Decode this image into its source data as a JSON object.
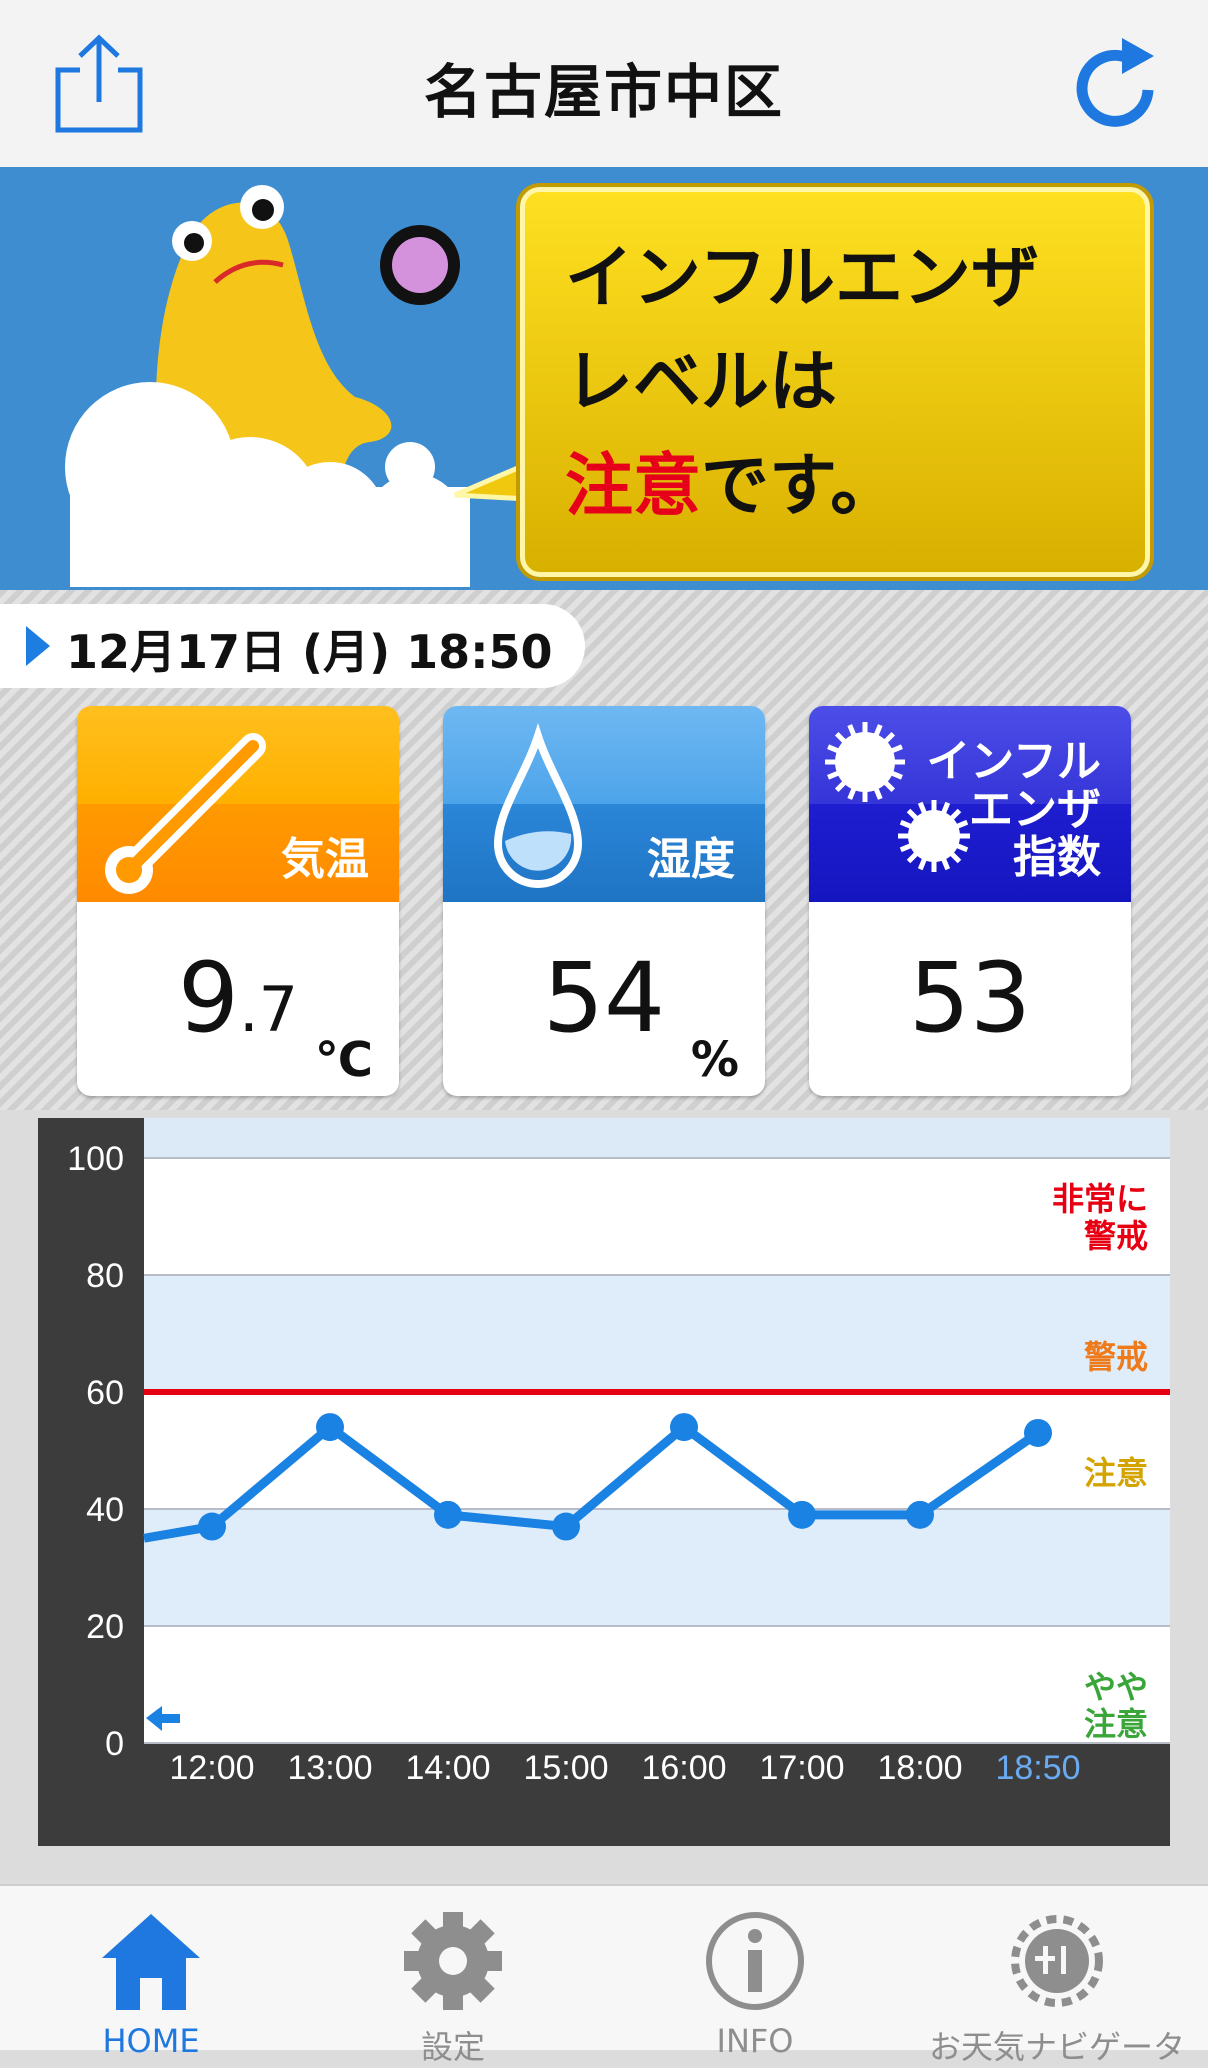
{
  "nav": {
    "title": "名古屋市中区",
    "share_icon": "share-icon",
    "refresh_icon": "refresh-icon",
    "accent": "#1f78e0"
  },
  "banner": {
    "line1": "インフルエンザ",
    "line2": "レベルは",
    "level": "注意",
    "suffix": "です。",
    "level_color": "#e6001a"
  },
  "datetime": "12月17日 (月) 18:50",
  "cards": {
    "temperature": {
      "label": "気温",
      "value_int": "9",
      "value_dec": ".7",
      "unit": "℃"
    },
    "humidity": {
      "label": "湿度",
      "value": "54",
      "unit": "%"
    },
    "influenza": {
      "label_lines": [
        "インフル",
        "エンザ",
        "指数"
      ],
      "value": "53"
    }
  },
  "chart_data": {
    "type": "line",
    "x": [
      "12:00",
      "13:00",
      "14:00",
      "15:00",
      "16:00",
      "17:00",
      "18:00",
      "18:50"
    ],
    "series": [
      {
        "values": [
          37,
          54,
          39,
          37,
          54,
          39,
          39,
          53
        ],
        "color": "#1a82e2"
      }
    ],
    "lead_in_value": 35,
    "ylim": [
      0,
      100
    ],
    "yticks": [
      "0",
      "20",
      "40",
      "60",
      "80",
      "100"
    ],
    "threshold": {
      "value": 60,
      "color": "#e60012"
    },
    "zones": [
      {
        "label": "非常に\n警戒",
        "color": "#e60012"
      },
      {
        "label": "警戒",
        "color": "#ee7a1a"
      },
      {
        "label": "注意",
        "color": "#d3a400"
      },
      {
        "label": "やや\n注意",
        "color": "#3aa63a"
      }
    ],
    "current_label_color": "#6aaaf0",
    "grid": true
  },
  "tabs": [
    {
      "label": "HOME",
      "icon": "home-icon",
      "active": true
    },
    {
      "label": "設定",
      "icon": "gear-icon",
      "active": false
    },
    {
      "label": "INFO",
      "icon": "info-icon",
      "active": false
    },
    {
      "label": "お天気ナビゲータ",
      "icon": "navi-icon",
      "active": false
    }
  ]
}
